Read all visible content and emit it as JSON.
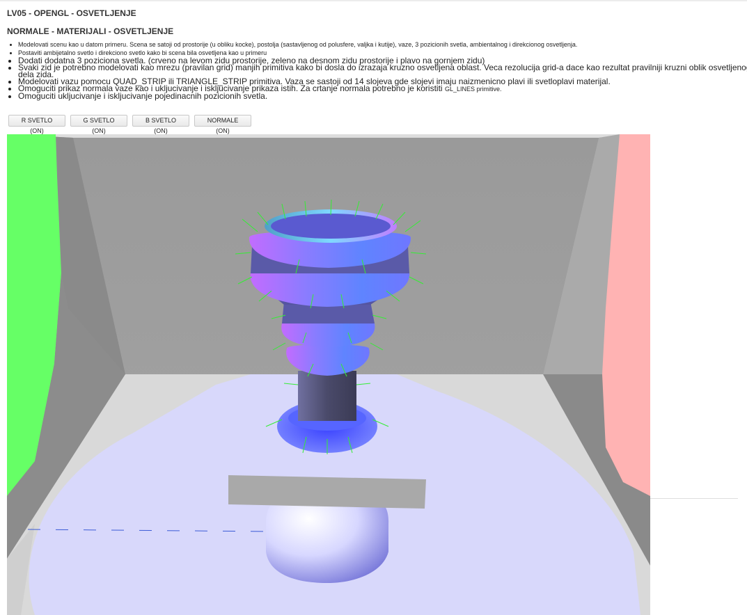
{
  "header": {
    "title": "LV05 - OPENGL - OSVETLJENJE",
    "subtitle": "NORMALE - MATERIJALI - OSVETLJENJE"
  },
  "tasks": [
    {
      "text": "Modelovati scenu kao u datom primeru. Scena se satoji od prostorije (u obliku kocke), postolja (sastavljenog od polusfere, valjka i kutije), vaze, 3 pozicionih svetla, ambientalnog i direkcionog osvetljenja.",
      "small": true
    },
    {
      "text": "Postaviti ambijetalno svetlo i direkciono svetlo kako bi scena bila osvetljena kao u primeru",
      "small": true
    },
    {
      "text": "Dodati dodatna 3 poziciona svetla. (crveno na levom zidu prostorije, zeleno na desnom zidu prostorije i plavo na gornjem zidu)",
      "small": false
    },
    {
      "text": "Svaki zid je potrebno modelovati kao mrezu (pravilan grid) manjih primitiva kako bi dosla do izrazaja kruzno osvetljena oblast.  Veca rezolucija grid-a dace kao rezultat pravilniji kruzni oblik osvetljenog dela zida.",
      "small": false
    },
    {
      "text": "Modelovati vazu pomocu QUAD_STRIP ili TRIANGLE_STRIP primitiva. Vaza se sastoji od 14 slojeva gde slojevi imaju naizmenicno plavi ili svetloplavi materijal.",
      "small": false
    },
    {
      "text": "Omoguciti prikaz normala vaze kao i ukljucivanje i iskljucivanje prikaza istih. Za crtanje normala potrebno je koristiti ",
      "code": "GL_LINES primitive.",
      "small": false
    },
    {
      "text": "Omoguciti ukljucivanje i iskljucivanje pojedinacnih pozicionih svetla.",
      "small": false
    }
  ],
  "buttons": {
    "r_light": "R SVETLO (ON)",
    "g_light": "G SVETLO (ON)",
    "b_light": "B SVETLO (ON)",
    "normals": "NORMALE (ON)"
  },
  "scene": {
    "colors": {
      "left_wall_light": "#66ff66",
      "right_wall_light": "#ffb3b3",
      "floor_light": "#d8d8fb",
      "wall_gray": "#8a8a8a",
      "back_wall": "#999999",
      "vase_blue": "#5b78ff",
      "vase_light": "#b07bff",
      "normals": "#33ee33",
      "pedestal_box": "#a9a9a9"
    }
  }
}
